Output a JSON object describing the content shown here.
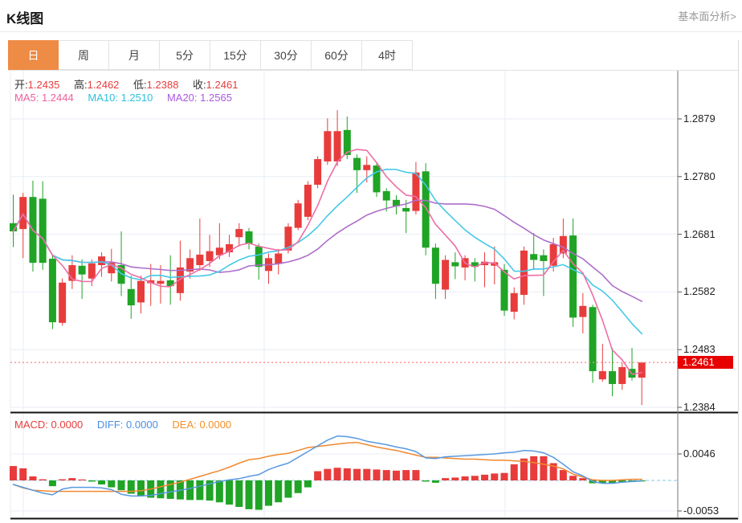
{
  "header": {
    "title": "K线图",
    "analysis_link": "基本面分析>"
  },
  "tabs": {
    "items": [
      "日",
      "周",
      "月",
      "5分",
      "15分",
      "30分",
      "60分",
      "4时"
    ],
    "selected": "日"
  },
  "ohlc_legend": {
    "open_label": "开:",
    "open": "1.2435",
    "high_label": "高:",
    "high": "1.2462",
    "low_label": "低:",
    "low": "1.2388",
    "close_label": "收:",
    "close": "1.2461"
  },
  "ma_legend": {
    "ma5_label": "MA5:",
    "ma5": "1.2444",
    "ma10_label": "MA10:",
    "ma10": "1.2510",
    "ma20_label": "MA20:",
    "ma20": "1.2565"
  },
  "macd_legend": {
    "macd_label": "MACD:",
    "macd": "0.0000",
    "diff_label": "DIFF:",
    "diff": "0.0000",
    "dea_label": "DEA:",
    "dea": "0.0000"
  },
  "price_axis": {
    "labels": [
      "1.2879",
      "1.2780",
      "1.2681",
      "1.2582",
      "1.2483",
      "1.2384"
    ],
    "current_price": "1.2461"
  },
  "macd_axis": {
    "labels": [
      "0.0046",
      "-0.0053"
    ]
  },
  "colors": {
    "up": "#e83c3c",
    "down": "#1fa425",
    "ma5": "#ee6ea5",
    "ma10": "#45c8e8",
    "ma20": "#ae6ec9",
    "diff_line": "#5899e0",
    "dea_line": "#f08830",
    "grid": "#e8edf4",
    "zero_dash": "#86c9e6",
    "current_line": "#ff8b8b",
    "badge": "#e60000",
    "tab_selected": "#ee8b45",
    "axis_line": "#777",
    "panel_border": "#111"
  },
  "chart_data": {
    "type": "candlestick+macd",
    "title": "K线图",
    "legend_position": "top-left-overlay",
    "grid": true,
    "price_ylim": [
      1.2384,
      1.2879
    ],
    "price_gridline_values": [
      1.2879,
      1.278,
      1.2681,
      1.2582,
      1.2483,
      1.2384
    ],
    "current_price": 1.2461,
    "candles_ohlc": [
      [
        1.27,
        1.2749,
        1.2659,
        1.2686
      ],
      [
        1.269,
        1.2752,
        1.264,
        1.2745
      ],
      [
        1.2745,
        1.2773,
        1.2617,
        1.2632
      ],
      [
        1.2742,
        1.2772,
        1.262,
        1.2632
      ],
      [
        1.2639,
        1.2645,
        1.2518,
        1.253
      ],
      [
        1.2529,
        1.2605,
        1.2524,
        1.2598
      ],
      [
        1.2601,
        1.2645,
        1.2587,
        1.2628
      ],
      [
        1.2627,
        1.2638,
        1.257,
        1.2612
      ],
      [
        1.2605,
        1.2638,
        1.2592,
        1.2631
      ],
      [
        1.2628,
        1.265,
        1.2608,
        1.2643
      ],
      [
        1.2614,
        1.2656,
        1.26,
        1.2632
      ],
      [
        1.2628,
        1.2686,
        1.2575,
        1.2596
      ],
      [
        1.2587,
        1.261,
        1.2536,
        1.2559
      ],
      [
        1.2564,
        1.261,
        1.2545,
        1.2601
      ],
      [
        1.2597,
        1.263,
        1.2558,
        1.2602
      ],
      [
        1.2596,
        1.2628,
        1.2562,
        1.2601
      ],
      [
        1.2602,
        1.2645,
        1.256,
        1.2592
      ],
      [
        1.258,
        1.267,
        1.2567,
        1.2624
      ],
      [
        1.2617,
        1.2655,
        1.2605,
        1.264
      ],
      [
        1.2628,
        1.2708,
        1.2618,
        1.2646
      ],
      [
        1.2635,
        1.268,
        1.2625,
        1.2652
      ],
      [
        1.2645,
        1.27,
        1.2638,
        1.2658
      ],
      [
        1.265,
        1.268,
        1.2642,
        1.2664
      ],
      [
        1.2676,
        1.27,
        1.266,
        1.269
      ],
      [
        1.2686,
        1.2692,
        1.2655,
        1.2665
      ],
      [
        1.266,
        1.2665,
        1.2603,
        1.2625
      ],
      [
        1.2618,
        1.2648,
        1.2596,
        1.264
      ],
      [
        1.263,
        1.2656,
        1.2612,
        1.2648
      ],
      [
        1.2653,
        1.27,
        1.2648,
        1.2694
      ],
      [
        1.2692,
        1.274,
        1.2688,
        1.2734
      ],
      [
        1.2711,
        1.2772,
        1.2705,
        1.2766
      ],
      [
        1.2766,
        1.2815,
        1.276,
        1.281
      ],
      [
        1.2806,
        1.288,
        1.28,
        1.2858
      ],
      [
        1.2806,
        1.2894,
        1.2798,
        1.2858
      ],
      [
        1.286,
        1.2883,
        1.281,
        1.2817
      ],
      [
        1.2812,
        1.2818,
        1.2752,
        1.2791
      ],
      [
        1.2791,
        1.2815,
        1.277,
        1.28
      ],
      [
        1.2799,
        1.2805,
        1.2745,
        1.2753
      ],
      [
        1.2755,
        1.276,
        1.272,
        1.2739
      ],
      [
        1.274,
        1.2748,
        1.2715,
        1.2729
      ],
      [
        1.2726,
        1.274,
        1.2683,
        1.272
      ],
      [
        1.2721,
        1.2805,
        1.2715,
        1.2787
      ],
      [
        1.2789,
        1.2803,
        1.2645,
        1.2658
      ],
      [
        1.2658,
        1.2665,
        1.257,
        1.2596
      ],
      [
        1.2586,
        1.2645,
        1.257,
        1.2637
      ],
      [
        1.2633,
        1.265,
        1.2604,
        1.2626
      ],
      [
        1.2624,
        1.2645,
        1.2602,
        1.264
      ],
      [
        1.2633,
        1.264,
        1.26,
        1.2625
      ],
      [
        1.2628,
        1.265,
        1.259,
        1.2634
      ],
      [
        1.2627,
        1.266,
        1.2595,
        1.2633
      ],
      [
        1.262,
        1.263,
        1.2541,
        1.255
      ],
      [
        1.2548,
        1.259,
        1.2535,
        1.258
      ],
      [
        1.2577,
        1.266,
        1.256,
        1.2653
      ],
      [
        1.2647,
        1.2683,
        1.262,
        1.2637
      ],
      [
        1.2645,
        1.2655,
        1.2575,
        1.2635
      ],
      [
        1.2627,
        1.2675,
        1.2617,
        1.2664
      ],
      [
        1.2648,
        1.2708,
        1.264,
        1.2678
      ],
      [
        1.2679,
        1.2708,
        1.2522,
        1.2538
      ],
      [
        1.2539,
        1.258,
        1.2511,
        1.2558
      ],
      [
        1.2556,
        1.256,
        1.2426,
        1.2446
      ],
      [
        1.2432,
        1.2493,
        1.2428,
        1.2446
      ],
      [
        1.2446,
        1.2486,
        1.2403,
        1.2424
      ],
      [
        1.2424,
        1.246,
        1.2414,
        1.2453
      ],
      [
        1.245,
        1.2486,
        1.243,
        1.2435
      ],
      [
        1.2435,
        1.2462,
        1.2388,
        1.2461
      ]
    ],
    "ma_periods": [
      5,
      10,
      20
    ],
    "macd": {
      "ylim_labels": [
        0.0046,
        -0.0053
      ],
      "hist_x1e4": [
        25,
        21,
        7,
        2,
        -10,
        2,
        4,
        1,
        -2,
        -7,
        -12,
        -17,
        -23,
        -27,
        -30,
        -31,
        -32,
        -33,
        -34,
        -34,
        -35,
        -38,
        -42,
        -46,
        -50,
        -51,
        -44,
        -38,
        -30,
        -22,
        -12,
        16,
        20,
        22,
        21,
        20,
        20,
        19,
        18,
        17,
        18,
        18,
        -2,
        -4,
        4,
        5,
        7,
        8,
        10,
        12,
        13,
        28,
        38,
        42,
        42,
        30,
        18,
        8,
        4,
        -5,
        -5,
        -5,
        -3,
        -2,
        -1
      ],
      "diff_x1e4": [
        -7,
        -12,
        -17,
        -22,
        -25,
        -15,
        -12,
        -12,
        -12,
        -13,
        -16,
        -24,
        -27,
        -27,
        -26,
        -23,
        -20,
        -17,
        -14,
        -10,
        -6,
        -2,
        1,
        3,
        7,
        10,
        19,
        25,
        30,
        40,
        50,
        60,
        70,
        77,
        76,
        73,
        68,
        65,
        62,
        58,
        55,
        50,
        39,
        38,
        41,
        42,
        43,
        44,
        45,
        46,
        48,
        49,
        52,
        51,
        48,
        40,
        28,
        15,
        8,
        -2,
        -5,
        -5,
        -3,
        -2,
        -1
      ],
      "dea_x1e4": [
        -7,
        -13,
        -17,
        -18,
        -19,
        -19,
        -19,
        -19,
        -19,
        -19,
        -19,
        -19,
        -19,
        -18,
        -15,
        -11,
        -7,
        -3,
        2,
        7,
        12,
        17,
        23,
        30,
        36,
        38,
        42,
        45,
        47,
        52,
        57,
        59,
        61,
        63,
        65,
        66,
        62,
        58,
        55,
        52,
        48,
        44,
        40,
        40,
        39,
        38,
        37,
        37,
        36,
        35,
        35,
        34,
        33,
        31,
        28,
        25,
        20,
        11,
        6,
        1,
        0,
        0,
        1,
        2,
        2
      ]
    }
  }
}
